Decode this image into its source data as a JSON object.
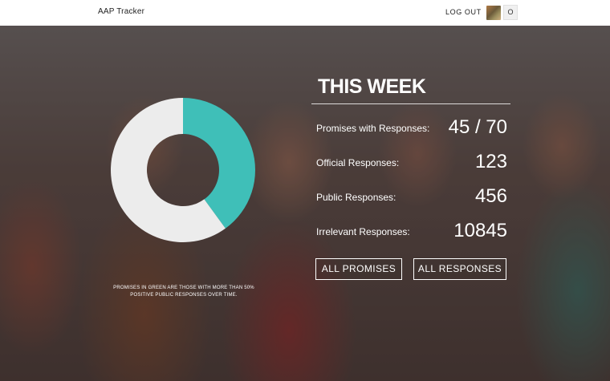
{
  "header": {
    "brand": "AAP Tracker",
    "logout_label": "LOG OUT",
    "user_initial": "O"
  },
  "stats": {
    "title": "THIS WEEK",
    "rows": [
      {
        "label": "Promises with Responses:",
        "value": "45 / 70"
      },
      {
        "label": "Official Responses:",
        "value": "123"
      },
      {
        "label": "Public Responses:",
        "value": "456"
      },
      {
        "label": "Irrelevant Responses:",
        "value": "10845"
      }
    ]
  },
  "chart": {
    "caption": "PROMISES IN GREEN ARE THOSE WITH MORE THAN 50% POSITIVE PUBLIC RESPONSES OVER TIME.",
    "colors": {
      "positive": "#3fbfb8",
      "remaining": "#ececec"
    }
  },
  "chart_data": {
    "type": "pie",
    "slices": [
      {
        "value": 40
      },
      {
        "value": 60
      }
    ]
  },
  "buttons": {
    "all_promises": "ALL PROMISES",
    "all_responses": "ALL RESPONSES"
  }
}
